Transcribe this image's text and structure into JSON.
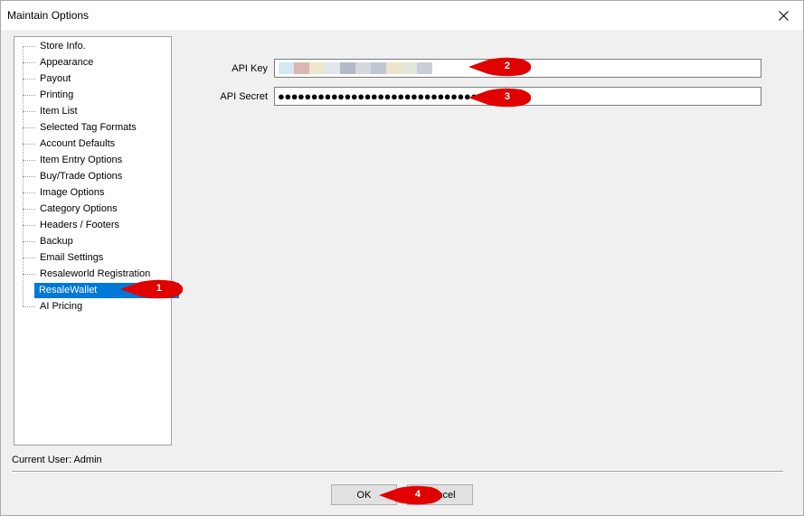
{
  "window": {
    "title": "Maintain Options"
  },
  "tree": {
    "items": [
      {
        "label": "Store Info."
      },
      {
        "label": "Appearance"
      },
      {
        "label": "Payout"
      },
      {
        "label": "Printing"
      },
      {
        "label": "Item List"
      },
      {
        "label": "Selected Tag Formats"
      },
      {
        "label": "Account Defaults"
      },
      {
        "label": "Item Entry Options"
      },
      {
        "label": "Buy/Trade Options"
      },
      {
        "label": "Image Options"
      },
      {
        "label": "Category Options"
      },
      {
        "label": "Headers / Footers"
      },
      {
        "label": "Backup"
      },
      {
        "label": "Email Settings"
      },
      {
        "label": "Resaleworld Registration"
      },
      {
        "label": "ResaleWallet"
      },
      {
        "label": "AI Pricing"
      }
    ],
    "selected_index": 15
  },
  "form": {
    "api_key_label": "API Key",
    "api_secret_label": "API Secret",
    "api_secret_value": "●●●●●●●●●●●●●●●●●●●●●●●●●●●●●●●●"
  },
  "callouts": [
    "1",
    "2",
    "3",
    "4"
  ],
  "status": {
    "current_user": "Current User: Admin"
  },
  "buttons": {
    "ok": "OK",
    "cancel": "Cancel"
  },
  "colors": {
    "selection": "#0078d7",
    "callout": "#e00000"
  }
}
